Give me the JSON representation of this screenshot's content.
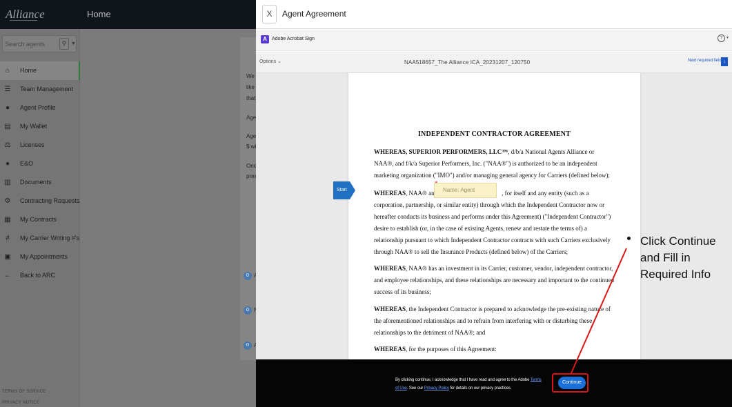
{
  "app": {
    "header_title": "Home",
    "logo_text": "Alliance",
    "search_placeholder": "Search agents",
    "search_icon": "magnifier-icon",
    "dropdown_icon": "chevron-down-icon"
  },
  "sidebar": {
    "items": [
      {
        "label": "Home",
        "icon": "home-icon",
        "glyph": "⌂"
      },
      {
        "label": "Team Management",
        "icon": "team-icon",
        "glyph": "☰"
      },
      {
        "label": "Agent Profile",
        "icon": "person-icon",
        "glyph": "●"
      },
      {
        "label": "My Wallet",
        "icon": "wallet-icon",
        "glyph": "▤"
      },
      {
        "label": "Licenses",
        "icon": "gavel-icon",
        "glyph": "⚖"
      },
      {
        "label": "E&O",
        "icon": "shield-icon",
        "glyph": "●"
      },
      {
        "label": "Documents",
        "icon": "documents-icon",
        "glyph": "▥"
      },
      {
        "label": "Contracting Requests",
        "icon": "request-icon",
        "glyph": "⚙"
      },
      {
        "label": "My Contracts",
        "icon": "contract-icon",
        "glyph": "▦"
      },
      {
        "label": "My Carrier Writing #'s",
        "icon": "hash-icon",
        "glyph": "#"
      },
      {
        "label": "My Appointments",
        "icon": "clipboard-icon",
        "glyph": "▣"
      },
      {
        "label": "Back to ARC",
        "icon": "arrow-left-icon",
        "glyph": "←"
      }
    ],
    "footer": [
      "TERMS OF SERVICE",
      "PRIVACY NOTICE"
    ]
  },
  "background_card": {
    "lines": [
      "We a",
      "like y",
      "that",
      "Agen",
      "Agen",
      "$ wil",
      "Once",
      "prese"
    ],
    "badges": [
      "0",
      "0",
      "0"
    ],
    "badge_suffixes": [
      "A",
      "N",
      "A"
    ]
  },
  "modal": {
    "title": "Agent Agreement",
    "close_label": "X",
    "acrobat_name": "Adobe Acrobat Sign",
    "acrobat_glyph": "A",
    "help_glyph": "?",
    "options_label": "Options ⌄",
    "document_name": "NAA518657_The Alliance ICA_20231207_120750",
    "next_required_label": "Next required field",
    "start_label": "Start",
    "name_field_placeholder": "Name: Agent",
    "doc_heading": "INDEPENDENT CONTRACTOR AGREEMENT",
    "paragraphs": {
      "p1_bold": "WHEREAS, SUPERIOR PERFORMERS, LLC™",
      "p1_rest": ", d/b/a National Agents Alliance or NAA®, and f/k/a Superior Performers, Inc. (\"NAA®\") is authorized to be an independent marketing organization (\"IMO\") and/or managing general agency for Carriers (defined below);",
      "p2_bold": "WHEREAS",
      "p2_a": ", NAA® and",
      "p2_b": ", for itself and any entity (such as a corporation, partnership, or similar entity) through which the Independent Contractor now or hereafter conducts its business and performs under this Agreement) (\"Independent Contractor\") desire to establish (or, in the case of existing Agents, renew and restate the terms of) a relationship pursuant to which Independent Contractor contracts with such Carriers exclusively through NAA® to sell the Insurance Products (defined below) of the Carriers;",
      "p3_bold": "WHEREAS",
      "p3_rest": ", NAA® has an investment in its Carrier, customer, vendor, independent contractor, and employee relationships, and these relationships are necessary and important to the continued success of its business;",
      "p4_bold": "WHEREAS",
      "p4_rest": ", the Independent Contractor is prepared to acknowledge the pre-existing nature of the aforementioned relationships and to refrain from interfering with or disturbing these relationships to the detriment of NAA®; and",
      "p5_bold": "WHEREAS",
      "p5_rest": ", for the purposes of this Agreement:"
    },
    "footer": {
      "text_a": "By clicking continue, I acknowledge that I have read and agree to the Adobe",
      "terms_link": "Terms of Use",
      "text_b": ". See our",
      "privacy_link": "Privacy Policy",
      "text_c": "for details on our privacy practices.",
      "continue_label": "Continue"
    }
  },
  "annotation": {
    "text": "Click Continue and Fill in Required Info",
    "color": "#d81616"
  }
}
